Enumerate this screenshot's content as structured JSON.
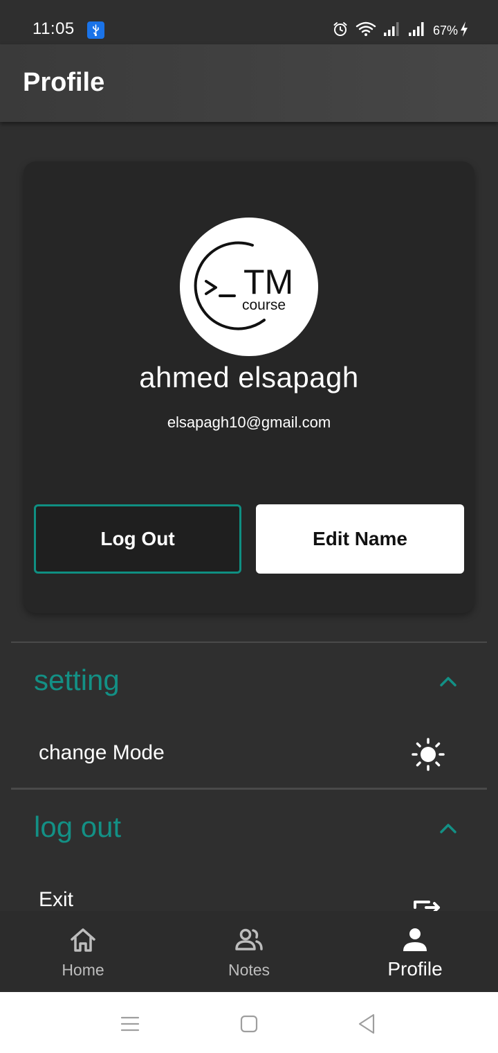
{
  "status_bar": {
    "time": "11:05",
    "battery": "67%",
    "icons": [
      "usb-icon",
      "alarm-icon",
      "wifi-icon",
      "signal-icon",
      "signal-icon",
      "charging-icon"
    ]
  },
  "app_bar": {
    "title": "Profile"
  },
  "profile": {
    "avatar_logo": {
      "mark": ">_",
      "title": "TM",
      "subtitle": "course"
    },
    "name": "ahmed elsapagh",
    "email": "elsapagh10@gmail.com",
    "logout_label": "Log Out",
    "edit_name_label": "Edit Name"
  },
  "sections": [
    {
      "title": "setting",
      "expanded": true,
      "items": [
        {
          "label": "change Mode",
          "icon": "sun-icon"
        }
      ]
    },
    {
      "title": "log out",
      "expanded": true,
      "items": [
        {
          "label": "Exit",
          "icon": "exit-icon"
        }
      ]
    }
  ],
  "bottom_nav": {
    "items": [
      {
        "label": "Home",
        "icon": "home-icon",
        "active": false
      },
      {
        "label": "Notes",
        "icon": "people-icon",
        "active": false
      },
      {
        "label": "Profile",
        "icon": "person-icon",
        "active": true
      }
    ]
  },
  "system_nav": [
    "menu-icon",
    "home-square-icon",
    "back-icon"
  ],
  "colors": {
    "background": "#2f2f2f",
    "card": "#262626",
    "accent": "#139085",
    "app_bar": "#474747",
    "text": "#ffffff",
    "nav_inactive": "#bdbdbd"
  }
}
